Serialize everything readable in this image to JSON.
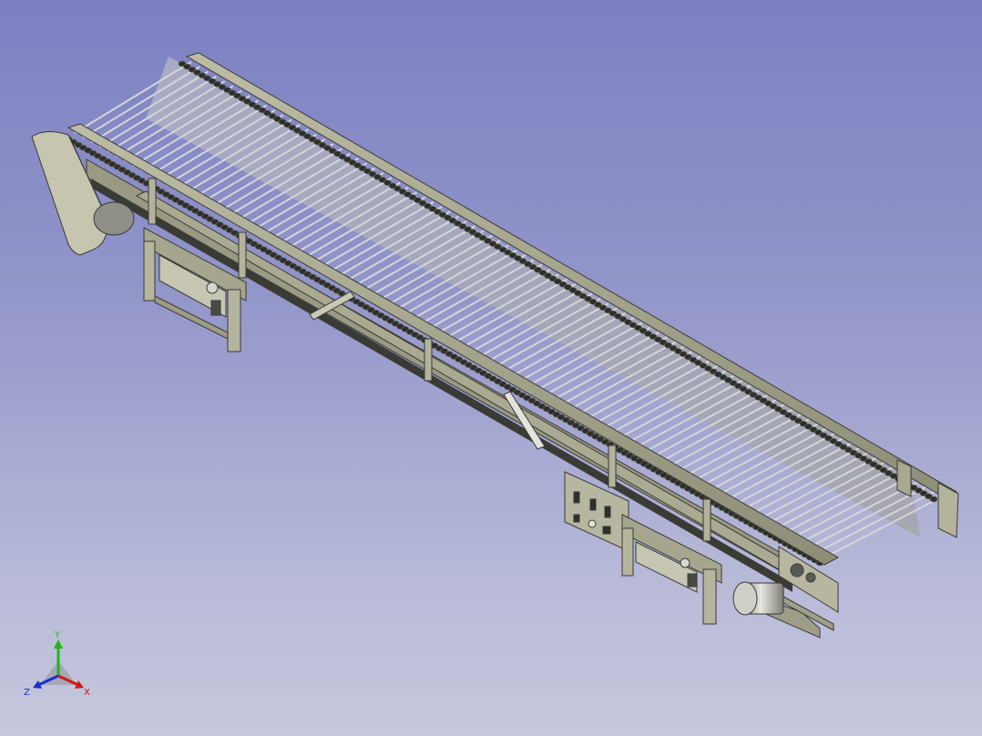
{
  "viewport": {
    "background_top": "#7c80c2",
    "background_bottom": "#c6c8dd"
  },
  "model": {
    "description_icon": "conveyor-3d-model",
    "colors": {
      "frame": "#a9a890",
      "frame_dark": "#6f6e5c",
      "chain": "#2e2e2a",
      "rod": "#d4d6d9",
      "edge": "#3a3a36"
    }
  },
  "triad": {
    "y_label": "Y",
    "z_label": "Z",
    "x_label": "X",
    "y_color": "#19b819",
    "x_color": "#d01818",
    "z_color": "#1a2ed0"
  }
}
